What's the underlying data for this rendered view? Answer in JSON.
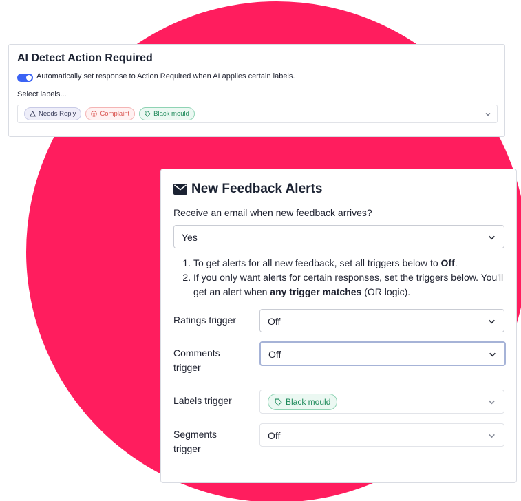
{
  "ai_card": {
    "title": "AI Detect Action Required",
    "toggle_on": true,
    "toggle_label": "Automatically set response to Action Required when AI applies certain labels.",
    "select_labels_text": "Select labels...",
    "tags": [
      {
        "label": "Needs Reply",
        "icon": "warning-triangle-icon"
      },
      {
        "label": "Complaint",
        "icon": "frown-face-icon"
      },
      {
        "label": "Black mould",
        "icon": "tag-icon"
      }
    ]
  },
  "feedback_card": {
    "title": "New Feedback Alerts",
    "title_icon": "envelope-icon",
    "question": "Receive an email when new feedback arrives?",
    "email_select_value": "Yes",
    "steps": {
      "step1_prefix": "To get alerts for all new feedback, set all triggers below to ",
      "step1_bold": "Off",
      "step1_suffix": ".",
      "step2_prefix": "If you only want alerts for certain responses, set the triggers below. You'll get an alert when ",
      "step2_bold": "any trigger matches",
      "step2_suffix": " (OR logic)."
    },
    "ratings_label": "Ratings trigger",
    "ratings_value": "Off",
    "comments_label": "Comments trigger",
    "comments_value": "Off",
    "labels_label": "Labels trigger",
    "labels_tag": "Black mould",
    "segments_label": "Segments trigger",
    "segments_value": "Off"
  },
  "colors": {
    "accent": "#3b63f4",
    "background_blob": "#ff1d5e",
    "tag_green": "#1f8a5b",
    "tag_red": "#d9534f"
  }
}
